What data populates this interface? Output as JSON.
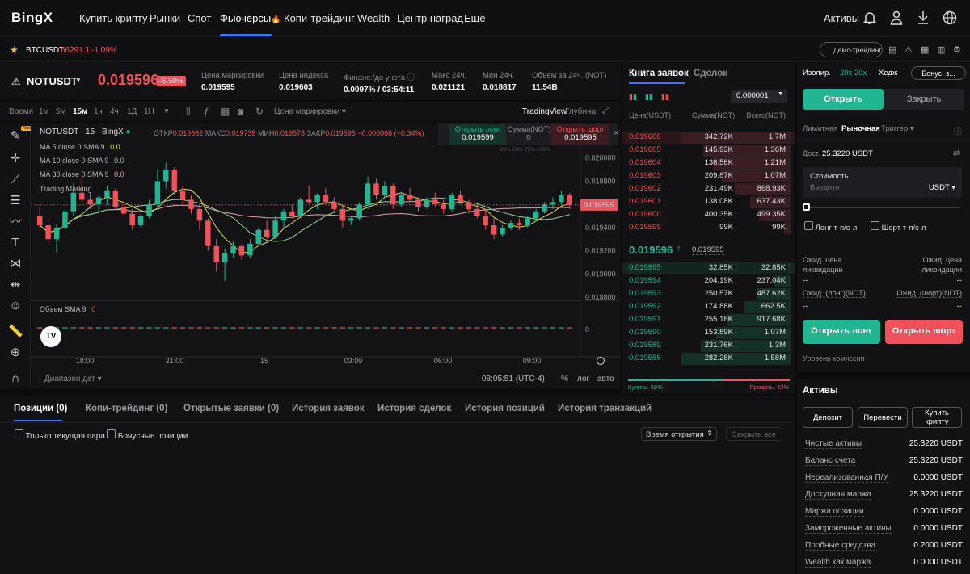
{
  "nav": {
    "logo": "BingX",
    "items": [
      "Купить крипту",
      "Рынки",
      "Спот",
      "Фьючерсы",
      "Копи-трейдинг",
      "Wealth",
      "Центр наград",
      "Ещё"
    ],
    "fire": "🔥",
    "assets": "Активы"
  },
  "ticker": {
    "symbol": "BTCUSDT",
    "price": "66291.1",
    "change": "-1.09%",
    "demo_label": "Демо-трейдинг"
  },
  "pair": {
    "name": "NOTUSDT",
    "price": "0.019596",
    "change": "-6.50%",
    "stats": [
      {
        "label": "Цена маркировки",
        "value": "0.019595"
      },
      {
        "label": "Цена индекса",
        "value": "0.019603"
      },
      {
        "label": "Финанс./до учета",
        "value": "0.0097% / 03:54:11"
      },
      {
        "label": "Макс 24ч.",
        "value": "0.021121"
      },
      {
        "label": "Мин 24ч.",
        "value": "0.018817"
      },
      {
        "label": "Объем за 24ч. (NOT)",
        "value": "11.54B"
      }
    ]
  },
  "toolbar": {
    "time_label": "Время",
    "intervals": [
      "1м",
      "5м",
      "15м",
      "1ч",
      "4ч",
      "1Д",
      "1Н"
    ],
    "active_interval": "15м",
    "price_type": "Цена маркировки",
    "tradingview": "TradingView",
    "depth": "Глубина"
  },
  "chart": {
    "legend_title": "NOTUSDT · 15 · BingX",
    "ohlc": {
      "o_label": "ОТКР",
      "o": "0.019662",
      "h_label": "МАКС",
      "h": "0.019735",
      "l_label": "МИН",
      "l": "0.019578",
      "c_label": "ЗАКР",
      "c": "0.019595",
      "chg": "−0.000066 (−0.34%)"
    },
    "ma": [
      {
        "label": "MA 5 close 0 SMA 9",
        "value": "0.0"
      },
      {
        "label": "MA 10 close 0 SMA 9",
        "value": "0.0"
      },
      {
        "label": "MA 30 close 0 SMA 9",
        "value": "0.0"
      }
    ],
    "trading_marking": "Trading Marking",
    "volume_label": "Объем SMA 9",
    "volume_value": "0",
    "open_long": "Открыть лонг",
    "open_long_price": "0.019599",
    "sum_label": "Сумма(NOT)",
    "sum_value": "0",
    "open_short": "Открыть шорт",
    "open_short_price": "0.019595",
    "pcts": [
      "25%",
      "50%",
      "75%",
      "100%"
    ],
    "y_ticks": [
      "0.020000",
      "0.019800",
      "0.019600",
      "0.019400",
      "0.019200",
      "0.019000",
      "0.018800"
    ],
    "current_price": "0.019595",
    "volume_zero": "0",
    "x_ticks": [
      "18:00",
      "21:00",
      "15",
      "03:00",
      "06:00",
      "09:00"
    ],
    "date_range": "Диапазон дат",
    "clock": "08:05:51 (UTC-4)",
    "scale_pct": "%",
    "scale_log": "лог",
    "scale_auto": "авто",
    "candles": [
      [
        0.0195,
        0.01958,
        0.01939,
        0.01942
      ],
      [
        0.01942,
        0.01948,
        0.01924,
        0.0193
      ],
      [
        0.0193,
        0.01943,
        0.01918,
        0.0194
      ],
      [
        0.0194,
        0.01956,
        0.01938,
        0.01954
      ],
      [
        0.01954,
        0.01978,
        0.0195,
        0.0197
      ],
      [
        0.0197,
        0.01984,
        0.01962,
        0.01964
      ],
      [
        0.01964,
        0.0197,
        0.01956,
        0.0196
      ],
      [
        0.0196,
        0.01968,
        0.01952,
        0.01966
      ],
      [
        0.01966,
        0.01976,
        0.0196,
        0.01972
      ],
      [
        0.01972,
        0.01974,
        0.01956,
        0.01958
      ],
      [
        0.01958,
        0.01962,
        0.0195,
        0.01952
      ],
      [
        0.01952,
        0.01956,
        0.01938,
        0.01942
      ],
      [
        0.01942,
        0.01952,
        0.0194,
        0.0195
      ],
      [
        0.0195,
        0.01964,
        0.01948,
        0.0196
      ],
      [
        0.0196,
        0.0199,
        0.01956,
        0.0198
      ],
      [
        0.0198,
        0.01996,
        0.01974,
        0.0199
      ],
      [
        0.0199,
        0.01992,
        0.01968,
        0.01972
      ],
      [
        0.01972,
        0.01976,
        0.0196,
        0.01964
      ],
      [
        0.01964,
        0.01968,
        0.01952,
        0.01956
      ],
      [
        0.01956,
        0.0196,
        0.01938,
        0.01946
      ],
      [
        0.01946,
        0.01948,
        0.0192,
        0.01924
      ],
      [
        0.01924,
        0.0193,
        0.01902,
        0.0191
      ],
      [
        0.0191,
        0.01922,
        0.01894,
        0.01918
      ],
      [
        0.01918,
        0.01928,
        0.01914,
        0.01924
      ],
      [
        0.01924,
        0.01926,
        0.01912,
        0.01916
      ],
      [
        0.01916,
        0.0193,
        0.01914,
        0.01926
      ],
      [
        0.01926,
        0.0194,
        0.01924,
        0.01938
      ],
      [
        0.01938,
        0.01946,
        0.0193,
        0.01932
      ],
      [
        0.01932,
        0.0195,
        0.0193,
        0.01946
      ],
      [
        0.01946,
        0.01956,
        0.0194,
        0.01954
      ],
      [
        0.01954,
        0.0196,
        0.01948,
        0.0195
      ],
      [
        0.0195,
        0.01966,
        0.01948,
        0.01964
      ],
      [
        0.01964,
        0.01976,
        0.0196,
        0.01962
      ],
      [
        0.01962,
        0.0197,
        0.01956,
        0.01968
      ],
      [
        0.01968,
        0.01974,
        0.0196,
        0.01962
      ],
      [
        0.01962,
        0.01966,
        0.01954,
        0.01956
      ],
      [
        0.01956,
        0.0196,
        0.0194,
        0.01946
      ],
      [
        0.01946,
        0.0195,
        0.01942,
        0.01948
      ],
      [
        0.01948,
        0.01962,
        0.01946,
        0.0196
      ],
      [
        0.0196,
        0.01984,
        0.01956,
        0.01978
      ],
      [
        0.01978,
        0.01982,
        0.01964,
        0.01968
      ],
      [
        0.01968,
        0.0198,
        0.01966,
        0.01976
      ],
      [
        0.01976,
        0.01978,
        0.01956,
        0.0196
      ],
      [
        0.0196,
        0.0197,
        0.01958,
        0.01968
      ],
      [
        0.01968,
        0.01974,
        0.01962,
        0.01964
      ],
      [
        0.01964,
        0.01966,
        0.01954,
        0.01958
      ],
      [
        0.01958,
        0.01966,
        0.01956,
        0.01964
      ],
      [
        0.01964,
        0.0197,
        0.01958,
        0.0196
      ],
      [
        0.0196,
        0.01964,
        0.01952,
        0.01956
      ],
      [
        0.01956,
        0.0197,
        0.01954,
        0.01968
      ],
      [
        0.01968,
        0.01972,
        0.0196,
        0.01962
      ],
      [
        0.01962,
        0.01964,
        0.01952,
        0.01956
      ],
      [
        0.01956,
        0.0196,
        0.01948,
        0.0195
      ],
      [
        0.0195,
        0.01956,
        0.01938,
        0.01942
      ],
      [
        0.01942,
        0.01948,
        0.0193,
        0.01934
      ],
      [
        0.01934,
        0.01942,
        0.01932,
        0.0194
      ],
      [
        0.0194,
        0.01946,
        0.01938,
        0.01944
      ],
      [
        0.01944,
        0.01948,
        0.01938,
        0.01942
      ],
      [
        0.01942,
        0.0195,
        0.0194,
        0.01948
      ],
      [
        0.01948,
        0.01956,
        0.01946,
        0.01954
      ],
      [
        0.01954,
        0.01962,
        0.01952,
        0.0196
      ],
      [
        0.0196,
        0.01966,
        0.01956,
        0.01962
      ],
      [
        0.01962,
        0.01972,
        0.0196,
        0.01968
      ],
      [
        0.01968,
        0.0197,
        0.01956,
        0.019595
      ]
    ]
  },
  "orderbook": {
    "tab_book": "Книга заявок",
    "tab_trades": "Сделок",
    "precision": "0.000001",
    "h_price": "Цена(USDT)",
    "h_sum": "Сумма(NOT)",
    "h_total": "Всего(NOT)",
    "asks": [
      {
        "p": "0.019606",
        "s": "342.72K",
        "t": "1.7M",
        "d": 1.0
      },
      {
        "p": "0.019605",
        "s": "145.93K",
        "t": "1.36M",
        "d": 0.8
      },
      {
        "p": "0.019604",
        "s": "136.56K",
        "t": "1.21M",
        "d": 0.71
      },
      {
        "p": "0.019603",
        "s": "209.87K",
        "t": "1.07M",
        "d": 0.63
      },
      {
        "p": "0.019602",
        "s": "231.49K",
        "t": "868.93K",
        "d": 0.51
      },
      {
        "p": "0.019601",
        "s": "138.08K",
        "t": "637.43K",
        "d": 0.37
      },
      {
        "p": "0.019600",
        "s": "400.35K",
        "t": "499.35K",
        "d": 0.29
      },
      {
        "p": "0.019599",
        "s": "99K",
        "t": "99K",
        "d": 0.06
      }
    ],
    "mid_price": "0.019596",
    "mid_arrow": "↑",
    "mid_mark": "0.019595",
    "bids": [
      {
        "p": "0.019595",
        "s": "32.85K",
        "t": "32.85K",
        "d": 0.02
      },
      {
        "p": "0.019594",
        "s": "204.19K",
        "t": "237.04K",
        "d": 0.15
      },
      {
        "p": "0.019593",
        "s": "250.57K",
        "t": "487.62K",
        "d": 0.31
      },
      {
        "p": "0.019592",
        "s": "174.88K",
        "t": "662.5K",
        "d": 0.42
      },
      {
        "p": "0.019591",
        "s": "255.18K",
        "t": "917.68K",
        "d": 0.58
      },
      {
        "p": "0.019590",
        "s": "153.89K",
        "t": "1.07M",
        "d": 0.68
      },
      {
        "p": "0.019589",
        "s": "231.76K",
        "t": "1.3M",
        "d": 0.82
      },
      {
        "p": "0.019588",
        "s": "282.28K",
        "t": "1.58M",
        "d": 1.0
      }
    ],
    "buy_label": "Купить: 58%",
    "sell_label": "Продать: 42%",
    "buy_pct": 58
  },
  "bottom": {
    "tabs": [
      "Позиции (0)",
      "Копи-трейдинг (0)",
      "Открытые заявки (0)",
      "История заявок",
      "История сделок",
      "История позиций",
      "История транзакций"
    ],
    "only_current": "Только текущая пара",
    "bonus_positions": "Бонусные позиции",
    "sort": "Время открытия",
    "close_all": "Закрыть все"
  },
  "trade": {
    "margin_mode": "Изолир.",
    "leverage": "20x 20x",
    "hedge": "Хедж",
    "bonus": "Бонус. з...",
    "open": "Открыть",
    "close": "Закрыть",
    "order_types": [
      "Лимитная",
      "Рыночная",
      "Триггер"
    ],
    "available_label": "Дост.",
    "available_value": "25.3220 USDT",
    "cost_label": "Стоимость",
    "cost_placeholder": "Введите",
    "currency": "USDT",
    "long_tpsl": "Лонг т-п/с-л",
    "short_tpsl": "Шорт т-п/с-л",
    "liq_label": "Ожид. цена ликвидации",
    "liq_label2": "Ожид. цена ликвидации",
    "liq_value": "--",
    "liq_value2": "--",
    "exp_long": "Ожид. (лонг)(NOT)",
    "exp_short": "Ожид. (шорт)(NOT)",
    "exp_long_val": "--",
    "exp_short_val": "--",
    "open_long": "Открыть лонг",
    "open_short": "Открыть шорт",
    "fee_level": "Уровень комиссии"
  },
  "assets": {
    "title": "Активы",
    "deposit": "Депозит",
    "transfer": "Перевести",
    "buy_crypto": "Купить крипту",
    "rows": [
      {
        "k": "Чистые активы",
        "v": "25.3220 USDT"
      },
      {
        "k": "Баланс счета",
        "v": "25.3220 USDT"
      },
      {
        "k": "Нереализованная П/У",
        "v": "0.0000 USDT"
      },
      {
        "k": "Доступная маржа",
        "v": "25.3220 USDT"
      },
      {
        "k": "Маржа позиции",
        "v": "0.0000 USDT"
      },
      {
        "k": "Замороженные активы",
        "v": "0.0000 USDT"
      },
      {
        "k": "Пробные средства",
        "v": "0.2000 USDT"
      },
      {
        "k": "Wealth как маржа",
        "v": "0.0000 USDT"
      }
    ]
  },
  "colors": {
    "up": "#22b592",
    "down": "#f0515a",
    "accent": "#3a74ff"
  }
}
